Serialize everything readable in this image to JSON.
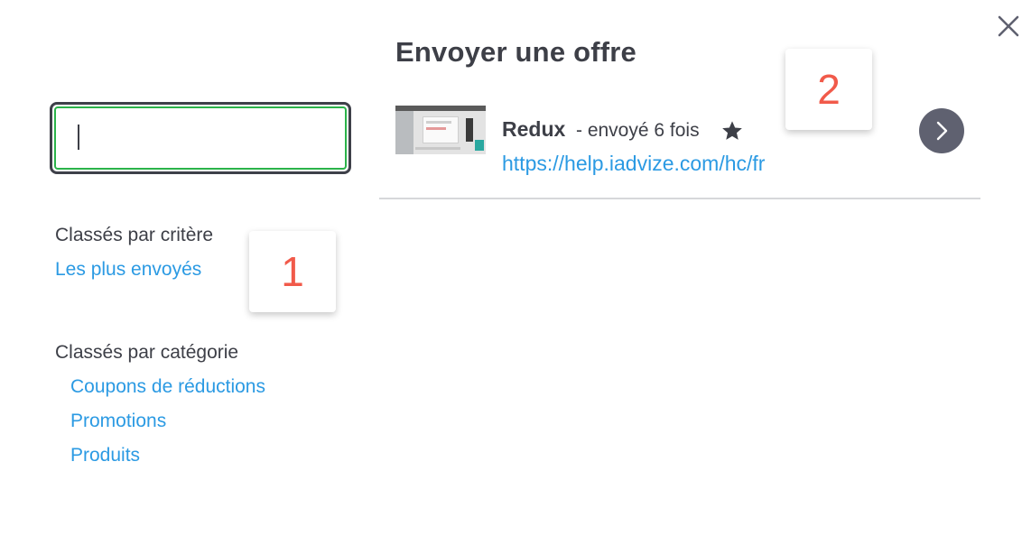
{
  "search": {
    "value": "",
    "placeholder": ""
  },
  "sidebar": {
    "criteria_title": "Classés par critère",
    "criteria_links": [
      {
        "label": "Les plus envoyés"
      }
    ],
    "category_title": "Classés par catégorie",
    "category_links": [
      {
        "label": "Coupons de réductions"
      },
      {
        "label": "Promotions"
      },
      {
        "label": "Produits"
      }
    ]
  },
  "panel": {
    "title": "Envoyer une offre",
    "offers": [
      {
        "name": "Redux",
        "meta": "- envoyé 6 fois",
        "url": "https://help.iadvize.com/hc/fr",
        "favorite": true,
        "thumbnail_icon": "screenshot-thumbnail"
      }
    ]
  },
  "annotations": {
    "marker_1": "1",
    "marker_2": "2"
  },
  "icons": {
    "close": "close-icon",
    "star": "star-icon",
    "next": "chevron-right-icon"
  },
  "colors": {
    "accent_link": "#2b9ae3",
    "input_focus": "#2bb34a",
    "marker_number": "#f15a4a",
    "next_button": "#5f6170"
  }
}
